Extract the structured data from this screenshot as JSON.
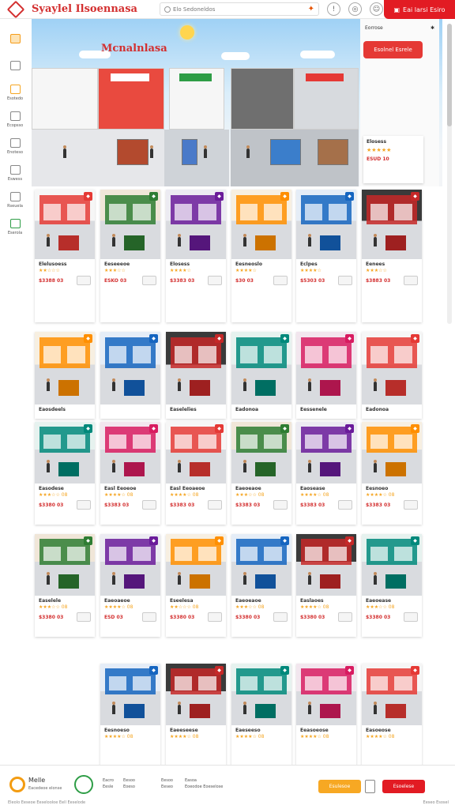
{
  "header": {
    "brand": "Syaylel Ilsoennasa",
    "search_placeholder": "Elo Sedoneldos",
    "cta": "Eai larsi Esiro"
  },
  "sidebar": {
    "items": [
      {
        "label": ""
      },
      {
        "label": ""
      },
      {
        "label": "Esotedo"
      },
      {
        "label": "Ecopsso"
      },
      {
        "label": "Enoteso"
      },
      {
        "label": "Eswess"
      },
      {
        "label": "Rseuela"
      },
      {
        "label": "Eserola"
      }
    ]
  },
  "hero": {
    "title": "Mcnalnlasa",
    "promo_top": "Eorrose",
    "promo_pill": "Esolnel Esrele",
    "promo_card_title": "Elosess",
    "promo_card_rating": "★★★★★",
    "promo_card_price": "ESUD 10"
  },
  "rows": [
    [
      {
        "title": "Elelusoess",
        "stars": "★★☆☆☆",
        "price": "$3388 03"
      },
      {
        "title": "Eeseeeoe",
        "stars": "★★★☆☆",
        "price": "ESKO 03"
      },
      {
        "title": "Elosess",
        "stars": "★★★★☆",
        "price": "$3383 03"
      },
      {
        "title": "Eesneoslo",
        "stars": "★★★★☆",
        "price": "$30 03"
      },
      {
        "title": "Eclpes",
        "stars": "★★★★☆",
        "price": "$5303 03"
      },
      {
        "title": "Eenees",
        "stars": "★★★☆☆",
        "price": "$3883 03"
      }
    ],
    [
      {
        "title": "Eaosdeels"
      },
      {
        "title": ""
      },
      {
        "title": "Easelelies"
      },
      {
        "title": "Eadonoa"
      },
      {
        "title": "Eessenele"
      },
      {
        "title": "Eadonoa"
      }
    ],
    [
      {
        "title": "Easodese",
        "stars": "★★★☆☆ 08",
        "price": "$3380 03"
      },
      {
        "title": "Easl Eeoeoe",
        "stars": "★★★★☆ 08",
        "price": "$3383 03"
      },
      {
        "title": "Easl Eeoaeoe",
        "stars": "★★★★☆ 08",
        "price": "$3383 03"
      },
      {
        "title": "Eaeoeaoe",
        "stars": "★★★☆☆ 08",
        "price": "$3383 03"
      },
      {
        "title": "Eaosease",
        "stars": "★★★★☆ 08",
        "price": "$3383 03"
      },
      {
        "title": "Eesnoeo",
        "stars": "★★★★☆ 08",
        "price": "$3383 03"
      }
    ],
    [
      {
        "title": "Easelele",
        "stars": "★★★☆☆ 08",
        "price": "$3380 03"
      },
      {
        "title": "Eaeoaeoe",
        "stars": "★★★★☆ 08",
        "price": "ESD 03"
      },
      {
        "title": "Eseelesa",
        "stars": "★★☆☆☆ 08",
        "price": "$3380 03"
      },
      {
        "title": "Eaeoeaoe",
        "stars": "★★★☆☆ 08",
        "price": "$3380 03"
      },
      {
        "title": "Easlaoes",
        "stars": "★★★★☆ 08",
        "price": "$3380 03"
      },
      {
        "title": "Eaeoease",
        "stars": "★★★☆☆ 08",
        "price": "$3380 03"
      }
    ],
    [
      {
        "title": "Eesnoeso",
        "stars": "★★★★☆ 08"
      },
      {
        "title": "Eaeeseese",
        "stars": "★★★★☆ 08"
      },
      {
        "title": "Eaeseeso",
        "stars": "★★★★☆ 08"
      },
      {
        "title": "Eeasoeose",
        "stars": "★★★★☆ 08"
      },
      {
        "title": "Easoeose",
        "stars": "★★★★☆ 08"
      }
    ]
  ],
  "footer": {
    "brand": "Melle",
    "sub": "Eacedeoe elonse",
    "links_1": [
      "Eacro",
      "Eesle"
    ],
    "links_2": [
      "Eesoo",
      "Eoeso"
    ],
    "links_3": [
      "Eesoo",
      "Eeseo"
    ],
    "links_4": [
      "Easoa",
      "Eoeodoe Eoeselose"
    ],
    "btn_primary": "Esulesoe",
    "btn_secondary": "Esoelese",
    "fine": "Eleolo Eeseoe Eeselooloe Eell Eeselode",
    "fine_right": "Eeseo Esosel"
  },
  "colors": {
    "brand_red": "#e21b23",
    "accent_orange": "#f7a823",
    "accent_green": "#2e9d46"
  }
}
